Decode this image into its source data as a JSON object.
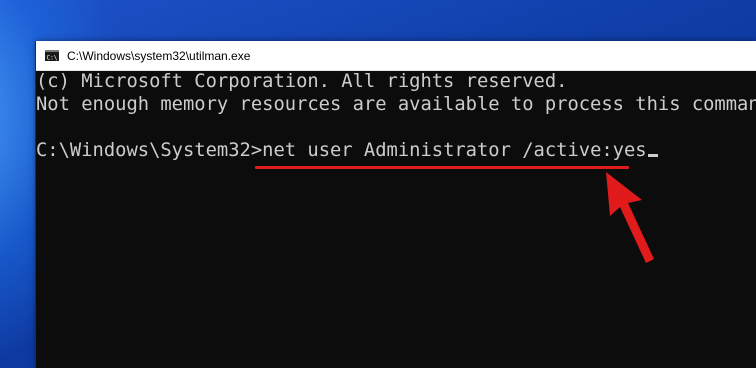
{
  "window": {
    "title": "C:\\Windows\\system32\\utilman.exe",
    "icon": "cmd-icon"
  },
  "console": {
    "line1": "(c) Microsoft Corporation. All rights reserved.",
    "line2": "Not enough memory resources are available to process this command.",
    "prompt": "C:\\Windows\\System32>",
    "command": "net user Administrator /active:yes"
  },
  "annotation": {
    "color": "#e11b1b"
  },
  "colors": {
    "console_bg": "#0c0c0c",
    "console_fg": "#cccccc",
    "titlebar_bg": "#ffffff"
  }
}
